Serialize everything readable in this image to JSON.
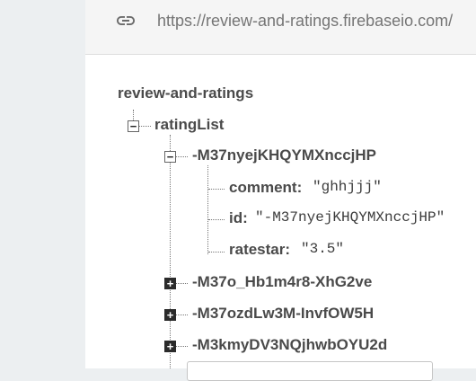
{
  "url": "https://review-and-ratings.firebaseio.com/",
  "tree": {
    "root": "review-and-ratings",
    "rating_list_label": "ratingList",
    "expanded_key": "-M37nyejKHQYMXnccjHP",
    "fields": [
      {
        "key": "comment:",
        "value": "\"ghhjjj\""
      },
      {
        "key": "id:",
        "value": "\"-M37nyejKHQYMXnccjHP\""
      },
      {
        "key": "ratestar:",
        "value": "\"3.5\""
      }
    ],
    "collapsed_keys": [
      "-M37o_Hb1m4r8-XhG2ve",
      "-M37ozdLw3M-InvfOW5H",
      "-M3kmyDV3NQjhwbOYU2d"
    ],
    "toggle_minus": "−",
    "toggle_plus": "+"
  }
}
